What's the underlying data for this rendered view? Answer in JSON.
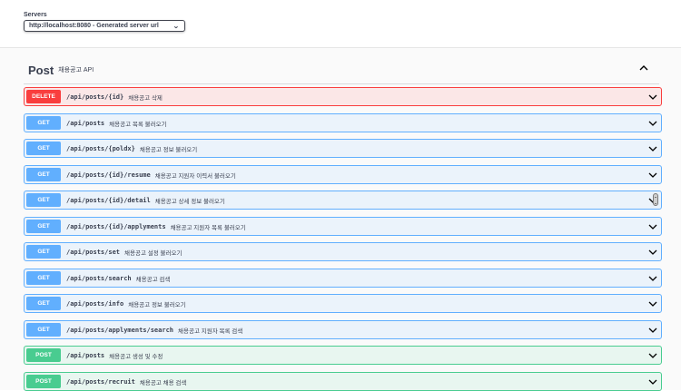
{
  "servers": {
    "label": "Servers",
    "selected": "http://localhost:8080 - Generated server url"
  },
  "tag": {
    "name": "Post",
    "description": "채용공고 API"
  },
  "operations": [
    {
      "method": "DELETE",
      "path": "/api/posts/{id}",
      "summary": "채용공고 삭제"
    },
    {
      "method": "GET",
      "path": "/api/posts",
      "summary": "채용공고 목록 불러오기"
    },
    {
      "method": "GET",
      "path": "/api/posts/{poldx}",
      "summary": "채용공고 정보 불러오기"
    },
    {
      "method": "GET",
      "path": "/api/posts/{id}/resume",
      "summary": "채용공고 지원자 이력서 불러오기"
    },
    {
      "method": "GET",
      "path": "/api/posts/{id}/detail",
      "summary": "채용공고 상세 정보 불러오기"
    },
    {
      "method": "GET",
      "path": "/api/posts/{id}/applyments",
      "summary": "채용공고 지원자 목록 불러오기"
    },
    {
      "method": "GET",
      "path": "/api/posts/set",
      "summary": "채용공고 설정 불러오기"
    },
    {
      "method": "GET",
      "path": "/api/posts/search",
      "summary": "채용공고 검색"
    },
    {
      "method": "GET",
      "path": "/api/posts/info",
      "summary": "채용공고 정보 불러오기"
    },
    {
      "method": "GET",
      "path": "/api/posts/applyments/search",
      "summary": "채용공고 지원자 목록 검색"
    },
    {
      "method": "POST",
      "path": "/api/posts",
      "summary": "채용공고 생성 및 수정"
    },
    {
      "method": "POST",
      "path": "/api/posts/recruit",
      "summary": "채용공고 채용 검색"
    }
  ],
  "icons": {
    "server_select": "chevron-down-icon",
    "tag_toggle": "chevron-up-icon",
    "operation_toggle": "chevron-down-icon"
  },
  "colors": {
    "get": "#61affe",
    "post": "#49cc90",
    "delete": "#f93e3e"
  }
}
